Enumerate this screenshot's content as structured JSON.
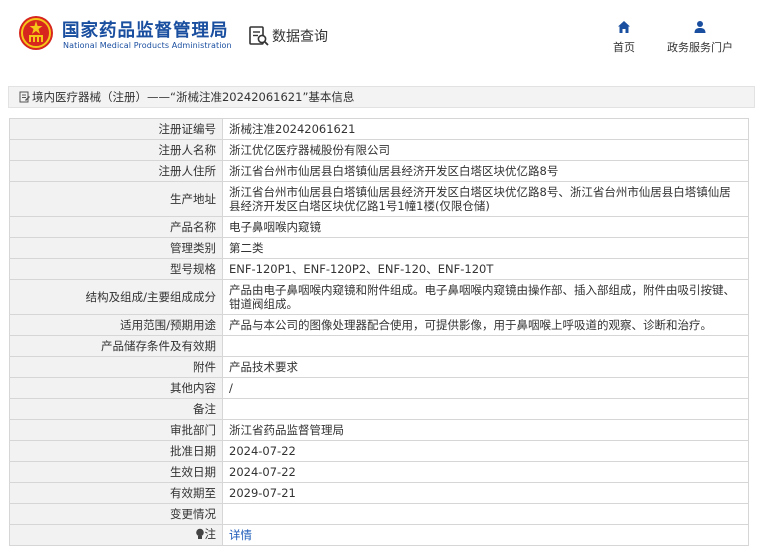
{
  "header": {
    "site_name": "国家药品监督管理局",
    "site_name_en": "National Medical Products Administration",
    "data_query": "数据查询",
    "nav_home": "首页",
    "nav_gov": "政务服务门户"
  },
  "breadcrumb": {
    "text": "境内医疗器械（注册）——“浙械注准20242061621”基本信息"
  },
  "details": [
    {
      "label": "注册证编号",
      "value": "浙械注准20242061621"
    },
    {
      "label": "注册人名称",
      "value": "浙江优亿医疗器械股份有限公司"
    },
    {
      "label": "注册人住所",
      "value": "浙江省台州市仙居县白塔镇仙居县经济开发区白塔区块优亿路8号"
    },
    {
      "label": "生产地址",
      "value": "浙江省台州市仙居县白塔镇仙居县经济开发区白塔区块优亿路8号、浙江省台州市仙居县白塔镇仙居县经济开发区白塔区块优亿路1号1幢1楼(仅限仓储)"
    },
    {
      "label": "产品名称",
      "value": "电子鼻咽喉内窥镜"
    },
    {
      "label": "管理类别",
      "value": "第二类"
    },
    {
      "label": "型号规格",
      "value": "ENF-120P1、ENF-120P2、ENF-120、ENF-120T"
    },
    {
      "label": "结构及组成/主要组成成分",
      "value": "产品由电子鼻咽喉内窥镜和附件组成。电子鼻咽喉内窥镜由操作部、插入部组成，附件由吸引按键、钳道阀组成。"
    },
    {
      "label": "适用范围/预期用途",
      "value": "产品与本公司的图像处理器配合使用，可提供影像，用于鼻咽喉上呼吸道的观察、诊断和治疗。"
    },
    {
      "label": "产品储存条件及有效期",
      "value": ""
    },
    {
      "label": "附件",
      "value": "产品技术要求"
    },
    {
      "label": "其他内容",
      "value": "/"
    },
    {
      "label": "备注",
      "value": ""
    },
    {
      "label": "审批部门",
      "value": "浙江省药品监督管理局"
    },
    {
      "label": "批准日期",
      "value": "2024-07-22"
    },
    {
      "label": "生效日期",
      "value": "2024-07-22"
    },
    {
      "label": "有效期至",
      "value": "2029-07-21"
    },
    {
      "label": "变更情况",
      "value": ""
    },
    {
      "label": "注",
      "value": "详情"
    }
  ],
  "colors": {
    "brand_blue": "#1a4fa0",
    "link_blue": "#1a58b8",
    "label_bg": "#f2f2f2",
    "border": "#d6d6d6"
  },
  "icons": [
    "national-emblem-icon",
    "data-query-icon",
    "home-icon",
    "user-icon",
    "document-icon",
    "bulb-icon"
  ]
}
